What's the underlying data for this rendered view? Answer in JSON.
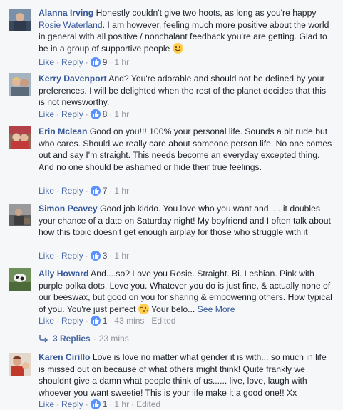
{
  "comments": [
    {
      "author": "Alanna Irving",
      "text_before": "Honestly couldn't give two hoots, as long as you're happy",
      "mention": "Rosie Waterland",
      "text_after": ". I am however, feeling much more positive about the world in general with all positive / nonchalant feedback you're are getting. Glad to be in a group of supportive people",
      "like": "Like",
      "reply": "Reply",
      "reactions": "9",
      "time": "1 hr",
      "avatar_icon": "profile-photo"
    },
    {
      "author": "Kerry Davenport",
      "text": "And? You're adorable and should not be defined by your preferences. I will be delighted when the rest of the planet decides that this is not newsworthy.",
      "like": "Like",
      "reply": "Reply",
      "reactions": "8",
      "time": "1 hr",
      "avatar_icon": "profile-photo"
    },
    {
      "author": "Erin Mclean",
      "text": "Good on you!!! 100% your personal life. Sounds a bit rude but who cares. Should we really care about someone person life. No one comes out and say I'm straight. This needs become an everyday excepted thing. And no one should be ashamed or hide their true feelings.",
      "like": "Like",
      "reply": "Reply",
      "reactions": "7",
      "time": "1 hr",
      "avatar_icon": "profile-photo"
    },
    {
      "author": "Simon Peavey",
      "text": "Good job kiddo. You love who you want and .... it doubles your chance of a date on Saturday night! My boyfriend and I often talk about how this topic doesn't get enough airplay for those who struggle with it",
      "like": "Like",
      "reply": "Reply",
      "reactions": "3",
      "time": "1 hr",
      "avatar_icon": "profile-photo"
    },
    {
      "author": "Ally Howard",
      "text": "And....so? Love you Rosie. Straight. Bi. Lesbian. Pink with purple polka dots. Love you. Whatever you do is just fine, & actually none of our beeswax, but good on you for sharing & empowering others. How typical of you. You're just perfect",
      "text_after": "Your belo...",
      "see_more": "See More",
      "like": "Like",
      "reply": "Reply",
      "reactions": "1",
      "time": "43 mins",
      "edited": "Edited",
      "replies_label": "3 Replies",
      "replies_time": "23 mins",
      "avatar_icon": "profile-photo"
    },
    {
      "author": "Karen Cirillo",
      "text": "Love is love no matter what gender it is with... so much in life is missed out on because of what others might think! Quite frankly we shouldnt give a damn what people think of us...... live, love, laugh with whoever you want sweetie! This is your life make it a good one!! Xx",
      "like": "Like",
      "reply": "Reply",
      "reactions": "1",
      "time": "1 hr",
      "edited": "Edited",
      "avatar_icon": "profile-photo"
    }
  ],
  "colors": {
    "link": "#365899",
    "meta": "#90949c",
    "reaction": "#5890ff",
    "background": "#f6f7f9"
  }
}
